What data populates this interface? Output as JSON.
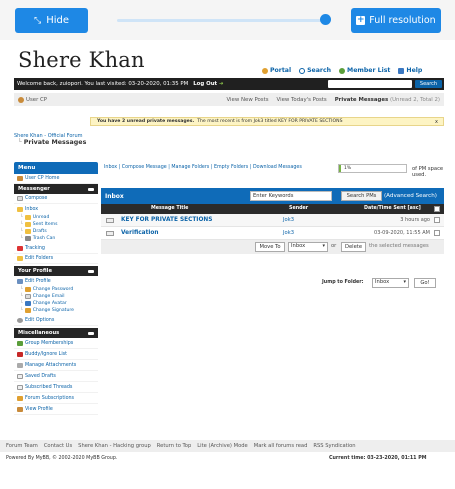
{
  "viewer": {
    "hide_label": "Hide",
    "full_label": "Full resolution"
  },
  "header": {
    "site_title": "Shere Khan",
    "links": [
      "Portal",
      "Search",
      "Member List",
      "Help"
    ]
  },
  "welcome": {
    "text": "Welcome back, zuiopori. You last visited: 03-20-2020, 01:35 PM",
    "logout": "Log Out",
    "search_button": "Search"
  },
  "subnav": {
    "user_cp": "User CP",
    "links": [
      "View New Posts",
      "View Today's Posts"
    ],
    "pm_label": "Private Messages",
    "pm_counts": "(Unread 2, Total 2)"
  },
  "notice": {
    "bold": "You have 2 unread private messages.",
    "text": "The most recent is from Jok3 titled KEY FOR PRIVATE SECTIONS",
    "close": "x"
  },
  "breadcrumb": {
    "forum": "Shere Khan - Official Forum",
    "current": "Private Messages"
  },
  "sidebar": {
    "menu_title": "Menu",
    "user_cp_home": "User CP Home",
    "messenger_title": "Messenger",
    "compose": "Compose",
    "inbox": "Inbox",
    "folders": [
      "Unread",
      "Sent Items",
      "Drafts",
      "Trash Can"
    ],
    "tracking": "Tracking",
    "edit_folders": "Edit Folders",
    "profile_title": "Your Profile",
    "edit_profile": "Edit Profile",
    "profile_items": [
      "Change Password",
      "Change Email",
      "Change Avatar",
      "Change Signature"
    ],
    "edit_options": "Edit Options",
    "misc_title": "Miscellaneous",
    "misc_items": [
      "Group Memberships",
      "Buddy/Ignore List",
      "Manage Attachments",
      "Saved Drafts",
      "Subscribed Threads",
      "Forum Subscriptions",
      "View Profile"
    ]
  },
  "pm": {
    "links": "Inbox | Compose Message | Manage Folders | Empty Folders | Download Messages",
    "quota_percent": 1,
    "quota_text": "1%",
    "quota_label": "of PM space used."
  },
  "inbox": {
    "title": "Inbox",
    "search_placeholder": "Enter Keywords",
    "search_button": "Search PMs",
    "advanced": "(Advanced Search)",
    "columns": [
      "Message Title",
      "Sender",
      "Date/Time Sent [asc]"
    ],
    "rows": [
      {
        "title": "KEY FOR PRIVATE SECTIONS",
        "sender": "Jok3",
        "date": "3 hours ago"
      },
      {
        "title": "Verification",
        "sender": "Jok3",
        "date": "03-09-2020, 11:55 AM"
      }
    ],
    "move_to": "Move To",
    "folder_select": "Inbox",
    "or": "or",
    "delete": "Delete",
    "selected_text": "the selected messages"
  },
  "jump": {
    "label": "Jump to Folder:",
    "value": "Inbox",
    "go": "Go!"
  },
  "footer": {
    "links": [
      "Forum Team",
      "Contact Us",
      "Shere Khan - Hacking group",
      "Return to Top",
      "Lite (Archive) Mode",
      "Mark all forums read",
      "RSS Syndication"
    ],
    "copyright": "Powered By MyBB, © 2002-2020 MyBB Group.",
    "current_time": "Current time: 03-23-2020, 01:11 PM"
  },
  "colors": {
    "viewer_blue": "#1e88e5",
    "forum_blue": "#0f6bb8",
    "link_blue": "#0b63a8",
    "notice_yellow": "#fdf4c4",
    "quota_green": "#77b344"
  }
}
